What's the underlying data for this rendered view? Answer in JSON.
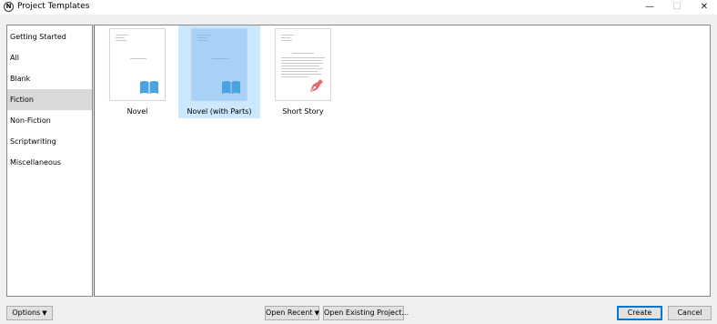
{
  "window": {
    "title": "Project Templates",
    "minimize_glyph": "—",
    "maximize_glyph": "☐",
    "close_glyph": "✕",
    "app_icon_glyph": "N"
  },
  "sidebar": {
    "items": [
      {
        "label": "Getting Started",
        "selected": false
      },
      {
        "label": "All",
        "selected": false
      },
      {
        "label": "Blank",
        "selected": false
      },
      {
        "label": "Fiction",
        "selected": true
      },
      {
        "label": "Non-Fiction",
        "selected": false
      },
      {
        "label": "Scriptwriting",
        "selected": false
      },
      {
        "label": "Miscellaneous",
        "selected": false
      }
    ]
  },
  "templates": [
    {
      "label": "Novel",
      "icon": "book-icon",
      "selected": false
    },
    {
      "label": "Novel (with Parts)",
      "icon": "book-icon",
      "selected": true
    },
    {
      "label": "Short Story",
      "icon": "fountain-pen-icon",
      "selected": false
    }
  ],
  "colors": {
    "book_icon": "#4aa3e0",
    "pen_icon": "#e5696e",
    "selection": "#cce8ff",
    "default_button_border": "#0078d7"
  },
  "footer": {
    "options_label": "Options",
    "open_recent_label": "Open Recent",
    "open_existing_label": "Open Existing Project...",
    "create_label": "Create",
    "cancel_label": "Cancel",
    "dropdown_glyph": "▼"
  }
}
